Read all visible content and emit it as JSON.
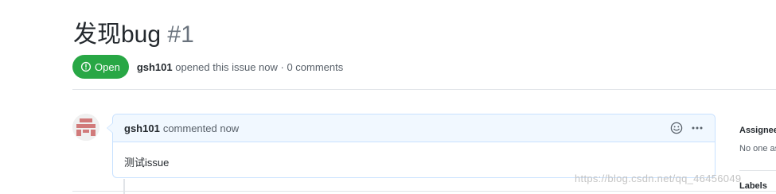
{
  "issue": {
    "title": "发现bug",
    "number": "#1",
    "state": "Open",
    "state_color": "#28a745",
    "author": "gsh101",
    "meta_suffix": "opened this issue now · 0 comments"
  },
  "comment": {
    "author": "gsh101",
    "time": "commented now",
    "body": "测试issue",
    "header_icons": [
      "smiley-icon",
      "kebab-horizontal-icon"
    ]
  },
  "sidebar": {
    "assignees_label": "Assignees",
    "assignees_value": "No one assigned",
    "labels_label": "Labels"
  },
  "watermark": "https://blog.csdn.net/qq_46456049"
}
